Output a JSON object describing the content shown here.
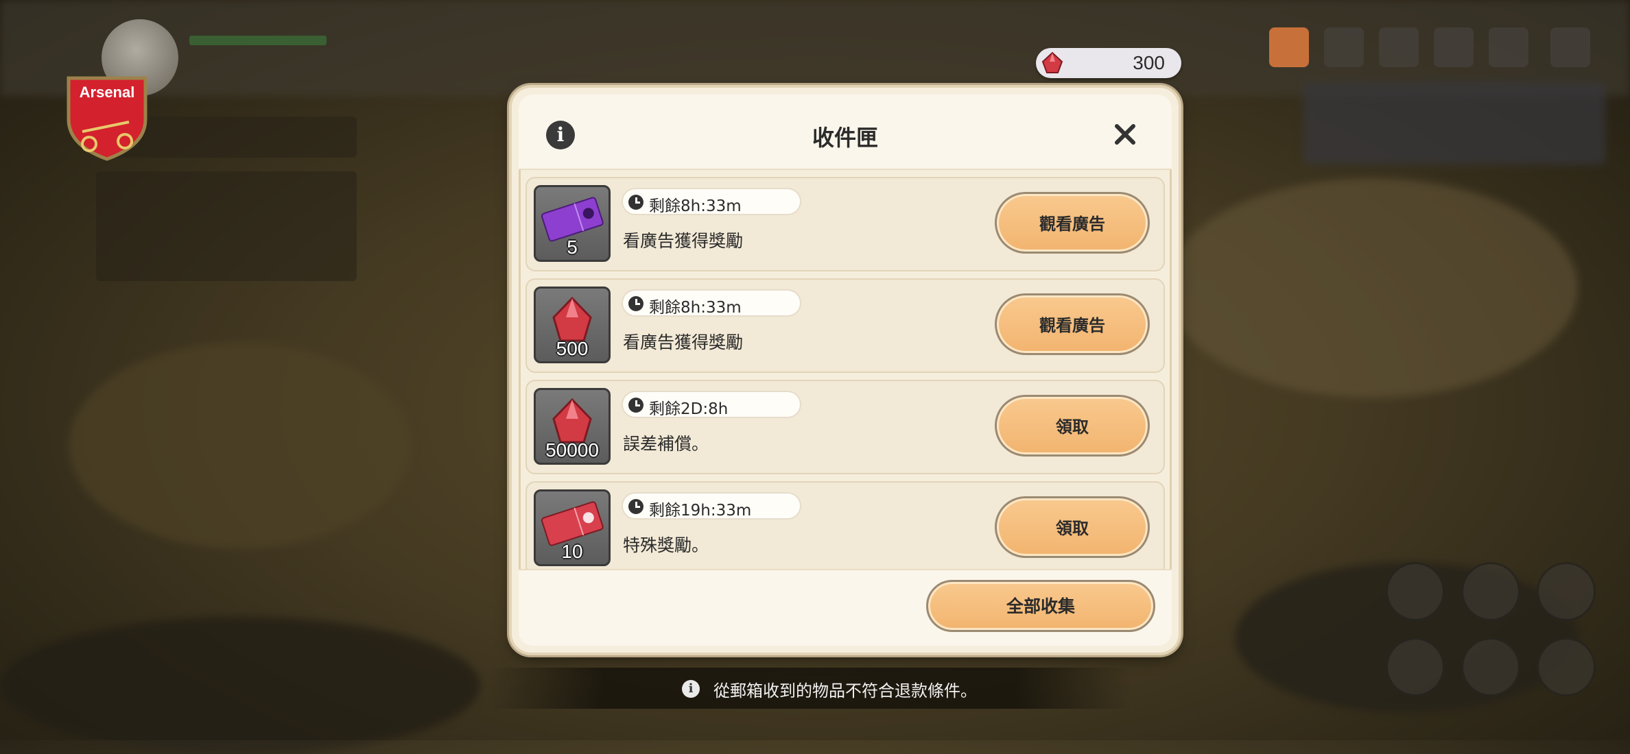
{
  "currency": {
    "icon": "red-gem-icon",
    "amount": "300"
  },
  "crest": {
    "label": "Arsenal"
  },
  "modal": {
    "title": "收件匣",
    "info_icon": "info-icon",
    "close_icon": "close-icon",
    "items": [
      {
        "icon": "purple-ticket-icon",
        "quantity": "5",
        "timer": "剩餘8h:33m",
        "description": "看廣告獲得獎勵",
        "action": "觀看廣告"
      },
      {
        "icon": "red-gem-icon",
        "quantity": "500",
        "timer": "剩餘8h:33m",
        "description": "看廣告獲得獎勵",
        "action": "觀看廣告"
      },
      {
        "icon": "red-gem-icon",
        "quantity": "50000",
        "timer": "剩餘2D:8h",
        "description": "誤差補償。",
        "action": "領取"
      },
      {
        "icon": "red-ticket-icon",
        "quantity": "10",
        "timer": "剩餘19h:33m",
        "description": "特殊獎勵。",
        "action": "領取"
      }
    ],
    "collect_all": "全部收集"
  },
  "notice": {
    "text": "從郵箱收到的物品不符合退款條件。"
  },
  "colors": {
    "button": "#f5be7c",
    "panel": "#f6eedd",
    "gem": "#d23a44"
  }
}
